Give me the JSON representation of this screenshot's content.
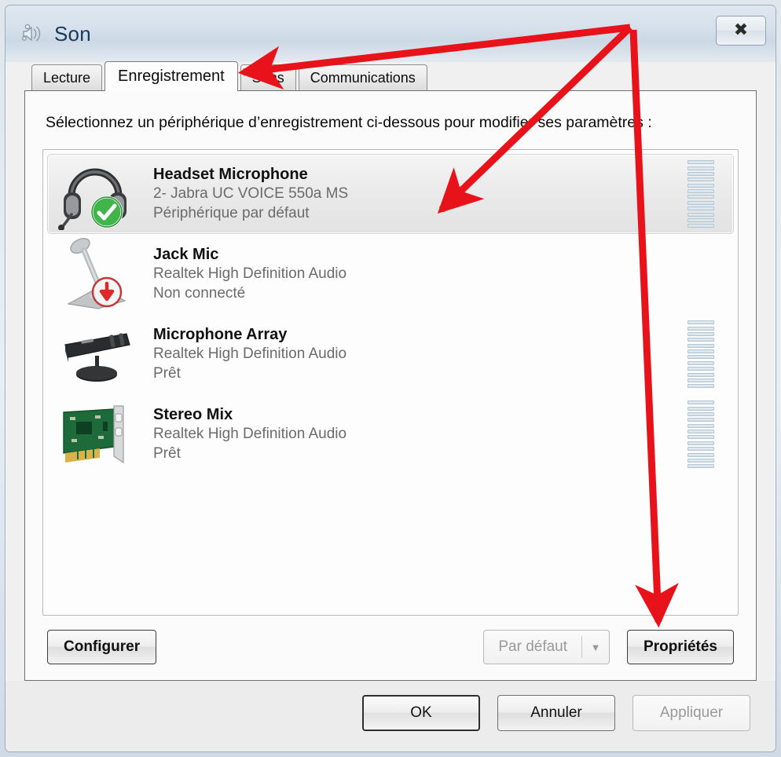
{
  "window": {
    "title": "Son",
    "icon": "sound-speaker-icon",
    "close_label": "✖"
  },
  "tabs": [
    {
      "label": "Lecture",
      "selected": false
    },
    {
      "label": "Enregistrement",
      "selected": true
    },
    {
      "label": "Sons",
      "selected": false
    },
    {
      "label": "Communications",
      "selected": false
    }
  ],
  "panel": {
    "instruction": "Sélectionnez un périphérique d’enregistrement ci-dessous pour modifier ses paramètres :"
  },
  "devices": [
    {
      "name": "Headset Microphone",
      "driver": "2- Jabra UC VOICE 550a MS",
      "status": "Périphérique par défaut",
      "icon": "headset-icon",
      "badge": "green-check-badge",
      "selected": true,
      "meter_segments": 12,
      "meter_visible": true
    },
    {
      "name": "Jack Mic",
      "driver": "Realtek High Definition Audio",
      "status": "Non connecté",
      "icon": "desk-microphone-icon",
      "badge": "red-down-arrow-badge",
      "selected": false,
      "meter_segments": 12,
      "meter_visible": false
    },
    {
      "name": "Microphone Array",
      "driver": "Realtek High Definition Audio",
      "status": "Prêt",
      "icon": "microphone-array-icon",
      "badge": "",
      "selected": false,
      "meter_segments": 12,
      "meter_visible": true
    },
    {
      "name": "Stereo Mix",
      "driver": "Realtek High Definition Audio",
      "status": "Prêt",
      "icon": "sound-card-icon",
      "badge": "",
      "selected": false,
      "meter_segments": 12,
      "meter_visible": true
    }
  ],
  "actions": {
    "configure": "Configurer",
    "set_default": "Par défaut",
    "set_default_disabled": true,
    "dropdown_glyph": "▼",
    "properties": "Propriétés"
  },
  "footer": {
    "ok": "OK",
    "cancel": "Annuler",
    "apply": "Appliquer",
    "apply_disabled": true
  },
  "annotations": {
    "color": "#e8131a",
    "arrow_count": 3,
    "targets": [
      "tab-enregistrement",
      "device-headset-microphone",
      "properties-button"
    ]
  }
}
